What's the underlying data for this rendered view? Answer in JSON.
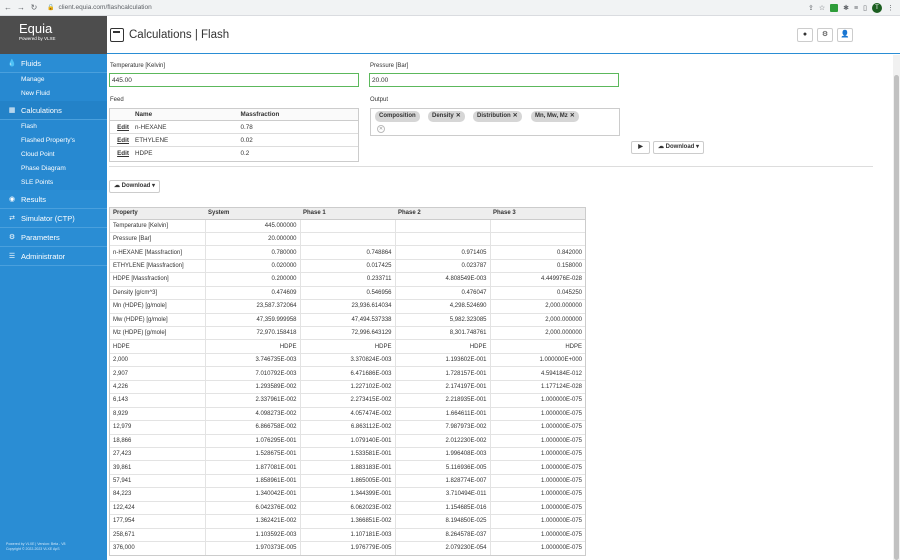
{
  "browser": {
    "url": "client.equia.com/flashcalculation",
    "profile_initial": "T"
  },
  "brand": {
    "name": "Equia",
    "sub": "Powered by VLXE",
    "footer1": "Powered by VLXE | Version: Beta - V8",
    "footer2": "Copyright © 2022-2023 VLXE ApS"
  },
  "sidebar": {
    "fluids": "Fluids",
    "manage": "Manage",
    "new_fluid": "New Fluid",
    "calculations": "Calculations",
    "flash": "Flash",
    "flashed_property": "Flashed Property's",
    "cloud_point": "Cloud Point",
    "phase_diagram": "Phase Diagram",
    "sle_points": "SLE Points",
    "results": "Results",
    "simulator": "Simulator (CTP)",
    "parameters": "Parameters",
    "administrator": "Administrator"
  },
  "header": {
    "title": "Calculations | Flash"
  },
  "form": {
    "temperature_label": "Temperature [Kelvin]",
    "temperature_value": "445.00",
    "pressure_label": "Pressure [Bar]",
    "pressure_value": "20.00",
    "feed_label": "Feed",
    "output_label": "Output",
    "feed_headers": [
      "Name",
      "Massfraction"
    ],
    "feed_rows": [
      {
        "edit": "Edit",
        "name": "n-HEXANE",
        "value": "0.78"
      },
      {
        "edit": "Edit",
        "name": "ETHYLENE",
        "value": "0.02"
      },
      {
        "edit": "Edit",
        "name": "HDPE",
        "value": "0.2"
      }
    ],
    "chips": [
      "Composition",
      "Density",
      "Distribution",
      "Mn, Mw, Mz"
    ],
    "download": "Download"
  },
  "results": {
    "download": "Download",
    "headers": [
      "Property",
      "System",
      "Phase 1",
      "Phase 2",
      "Phase 3"
    ],
    "rows": [
      [
        "Temperature [Kelvin]",
        "445.000000",
        "",
        "",
        ""
      ],
      [
        "Pressure [Bar]",
        "20.000000",
        "",
        "",
        ""
      ],
      [
        "n-HEXANE [Massfraction]",
        "0.780000",
        "0.748864",
        "0.971405",
        "0.842000"
      ],
      [
        "ETHYLENE [Massfraction]",
        "0.020000",
        "0.017425",
        "0.023787",
        "0.158000"
      ],
      [
        "HDPE [Massfraction]",
        "0.200000",
        "0.233711",
        "4.808549E-003",
        "4.449976E-028"
      ],
      [
        "Density [g/cm^3]",
        "0.474609",
        "0.546956",
        "0.476047",
        "0.045250"
      ],
      [
        "Mn (HDPE) [g/mole]",
        "23,587.372064",
        "23,936.614034",
        "4,298.524690",
        "2,000.000000"
      ],
      [
        "Mw (HDPE) [g/mole]",
        "47,359.999958",
        "47,494.537338",
        "5,982.323085",
        "2,000.000000"
      ],
      [
        "Mz (HDPE) [g/mole]",
        "72,970.158418",
        "72,996.643129",
        "8,301.748761",
        "2,000.000000"
      ],
      [
        "HDPE",
        "HDPE",
        "HDPE",
        "HDPE",
        "HDPE"
      ],
      [
        "2,000",
        "3.746735E-003",
        "3.370824E-003",
        "1.193602E-001",
        "1.000000E+000"
      ],
      [
        "2,907",
        "7.010792E-003",
        "6.471686E-003",
        "1.728157E-001",
        "4.594184E-012"
      ],
      [
        "4,226",
        "1.293589E-002",
        "1.227102E-002",
        "2.174197E-001",
        "1.177124E-028"
      ],
      [
        "6,143",
        "2.337961E-002",
        "2.273415E-002",
        "2.218935E-001",
        "1.000000E-075"
      ],
      [
        "8,929",
        "4.098273E-002",
        "4.057474E-002",
        "1.664611E-001",
        "1.000000E-075"
      ],
      [
        "12,979",
        "6.866758E-002",
        "6.863112E-002",
        "7.987973E-002",
        "1.000000E-075"
      ],
      [
        "18,866",
        "1.076295E-001",
        "1.079140E-001",
        "2.012230E-002",
        "1.000000E-075"
      ],
      [
        "27,423",
        "1.528675E-001",
        "1.533581E-001",
        "1.996408E-003",
        "1.000000E-075"
      ],
      [
        "39,861",
        "1.877081E-001",
        "1.883183E-001",
        "5.116936E-005",
        "1.000000E-075"
      ],
      [
        "57,941",
        "1.858961E-001",
        "1.865005E-001",
        "1.828774E-007",
        "1.000000E-075"
      ],
      [
        "84,223",
        "1.340042E-001",
        "1.344399E-001",
        "3.710494E-011",
        "1.000000E-075"
      ],
      [
        "122,424",
        "6.042376E-002",
        "6.062023E-002",
        "1.154685E-016",
        "1.000000E-075"
      ],
      [
        "177,954",
        "1.362421E-002",
        "1.366851E-002",
        "8.194850E-025",
        "1.000000E-075"
      ],
      [
        "258,671",
        "1.103592E-003",
        "1.107181E-003",
        "8.264578E-037",
        "1.000000E-075"
      ],
      [
        "376,000",
        "1.970373E-005",
        "1.976779E-005",
        "2.079230E-054",
        "1.000000E-075"
      ]
    ]
  }
}
